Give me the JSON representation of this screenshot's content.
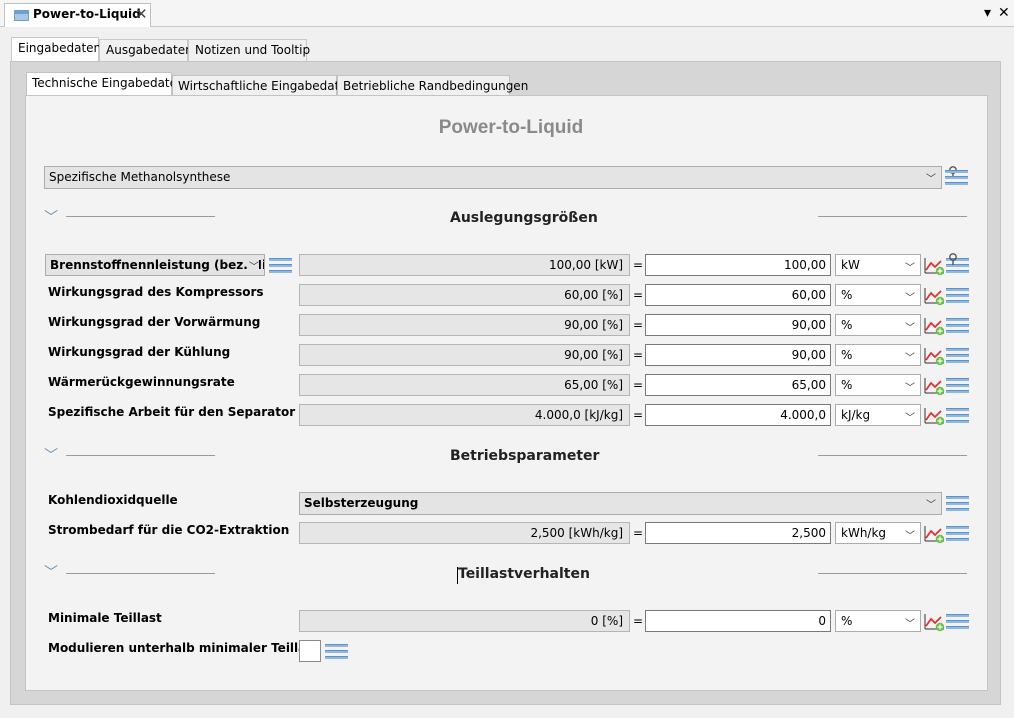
{
  "editor_tab": {
    "title": "Power-to-Liquid",
    "icon": "window-icon"
  },
  "window_controls": {
    "menu": "▾",
    "close": "✕"
  },
  "outer_tabs": [
    "Eingabedaten",
    "Ausgabedaten",
    "Notizen und Tooltip"
  ],
  "inner_tabs": [
    "Technische Eingabedaten",
    "Wirtschaftliche Eingabedaten",
    "Betriebliche Randbedingungen"
  ],
  "page_title": "Power-to-Liquid",
  "process_select": {
    "value": "Spezifische Methanolsynthese"
  },
  "sections": {
    "auslegung": "Auslegungsgrößen",
    "betrieb": "Betriebsparameter",
    "teillast": "Teillastverhalten"
  },
  "rows": [
    {
      "label": "Brennstoffnennleistung (bez. Hi/Hu)",
      "calc": "100,00 [kW]",
      "eq": "=",
      "value": "100,00",
      "unit": "kW"
    },
    {
      "label": "Wirkungsgrad des Kompressors",
      "calc": "60,00 [%]",
      "eq": "=",
      "value": "60,00",
      "unit": "%"
    },
    {
      "label": "Wirkungsgrad der Vorwärmung",
      "calc": "90,00 [%]",
      "eq": "=",
      "value": "90,00",
      "unit": "%"
    },
    {
      "label": "Wirkungsgrad der Kühlung",
      "calc": "90,00 [%]",
      "eq": "=",
      "value": "90,00",
      "unit": "%"
    },
    {
      "label": "Wärmerückgewinnungsrate",
      "calc": "65,00 [%]",
      "eq": "=",
      "value": "65,00",
      "unit": "%"
    },
    {
      "label": "Spezifische Arbeit für den Separator",
      "calc": "4.000,0 [kJ/kg]",
      "eq": "=",
      "value": "4.000,0",
      "unit": "kJ/kg"
    }
  ],
  "betrieb": {
    "co2_label": "Kohlendioxidquelle",
    "co2_value": "Selbsterzeugung",
    "strom": {
      "label": "Strombedarf für die CO2-Extraktion",
      "calc": "2,500 [kWh/kg]",
      "eq": "=",
      "value": "2,500",
      "unit": "kWh/kg"
    }
  },
  "teillast": {
    "min": {
      "label": "Minimale Teillast",
      "calc": "0 [%]",
      "eq": "=",
      "value": "0",
      "unit": "%"
    },
    "mod_label": "Modulieren unterhalb minimaler Teillast"
  }
}
